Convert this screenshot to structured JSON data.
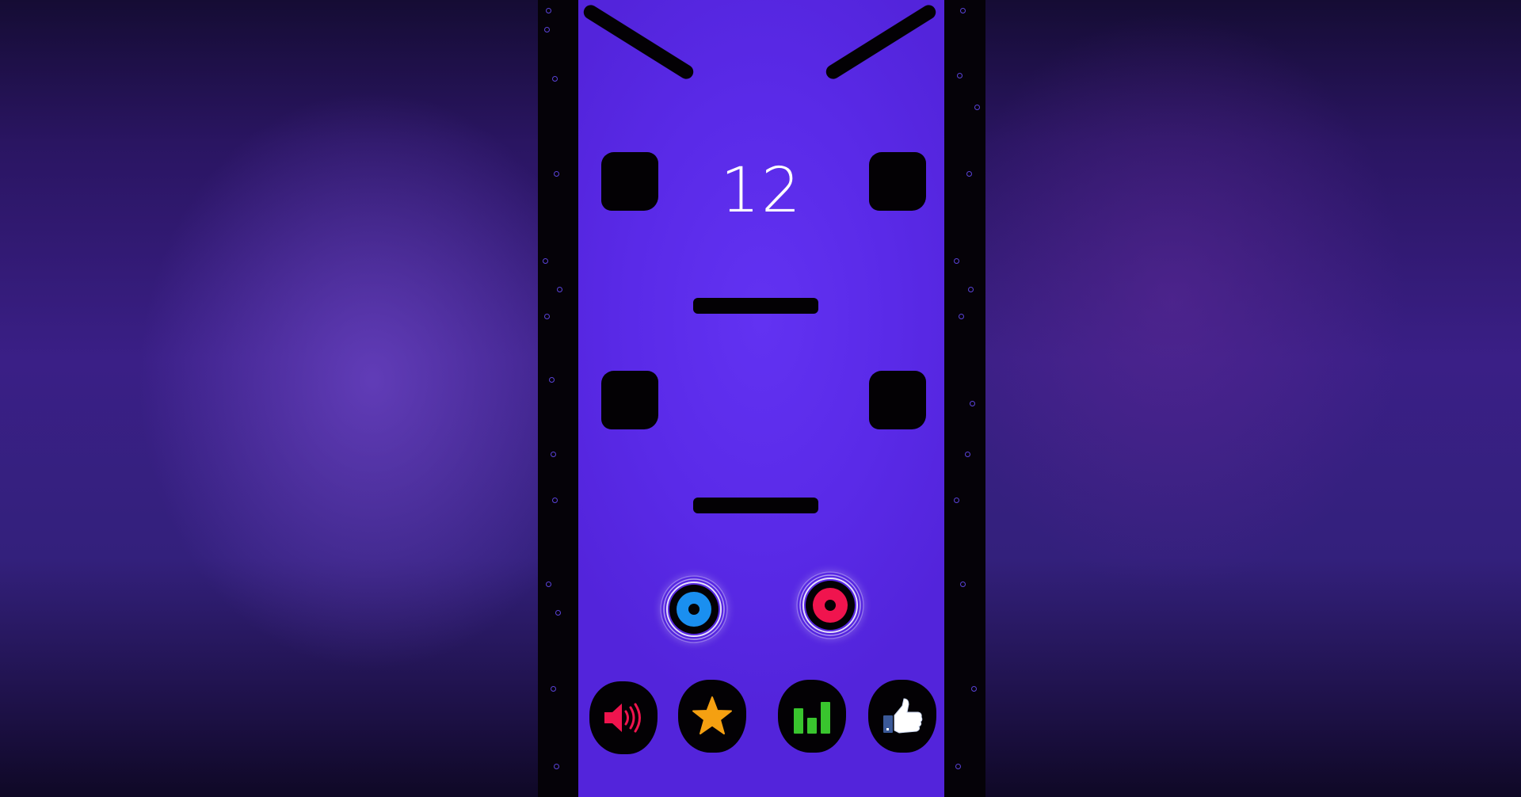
{
  "game": {
    "score": "12"
  },
  "players": [
    {
      "name": "blue-player",
      "color": "#1a8ff0"
    },
    {
      "name": "red-player",
      "color": "#f0144e"
    }
  ],
  "menu": {
    "buttons": [
      {
        "icon": "speaker-icon",
        "color": "#f0144e"
      },
      {
        "icon": "star-icon",
        "color": "#f5a011"
      },
      {
        "icon": "leaderboard-icon",
        "color": "#39c52e"
      },
      {
        "icon": "thumbs-up-icon",
        "color": "#3b5998"
      }
    ]
  },
  "colors": {
    "field": "#5a2ae8",
    "obstacle": "#030104",
    "background": "#2a1562"
  }
}
